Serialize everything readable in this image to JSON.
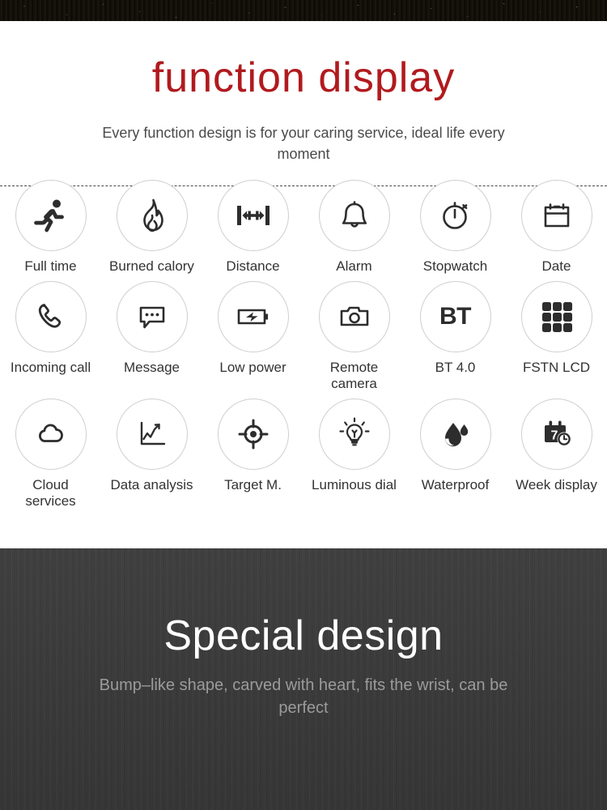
{
  "header": {
    "title": "function display",
    "subtitle": "Every function design is for your caring service, ideal life every moment"
  },
  "colors": {
    "title_red": "#b11a1e",
    "label_gray": "#333333",
    "icon_dark": "#2d2d2d",
    "circle_border": "#cfcfcf",
    "bottom_bg": "#3b3b3b",
    "bottom_subtitle": "#9b9b9b"
  },
  "features": [
    {
      "icon": "running-man-icon",
      "label": "Full time"
    },
    {
      "icon": "flame-icon",
      "label": "Burned calory"
    },
    {
      "icon": "distance-measure-icon",
      "label": "Distance"
    },
    {
      "icon": "bell-icon",
      "label": "Alarm"
    },
    {
      "icon": "stopwatch-icon",
      "label": "Stopwatch"
    },
    {
      "icon": "calendar-icon",
      "label": "Date"
    },
    {
      "icon": "phone-handset-icon",
      "label": "Incoming call"
    },
    {
      "icon": "speech-bubble-icon",
      "label": "Message"
    },
    {
      "icon": "battery-bolt-icon",
      "label": "Low power"
    },
    {
      "icon": "camera-icon",
      "label": "Remote camera"
    },
    {
      "icon": "bluetooth-text-icon",
      "label": "BT 4.0",
      "icon_text": "BT"
    },
    {
      "icon": "grid-squares-icon",
      "label": "FSTN LCD"
    },
    {
      "icon": "cloud-icon",
      "label": "Cloud services"
    },
    {
      "icon": "line-chart-icon",
      "label": "Data analysis"
    },
    {
      "icon": "crosshair-target-icon",
      "label": "Target M."
    },
    {
      "icon": "lightbulb-icon",
      "label": "Luminous dial"
    },
    {
      "icon": "water-drop-icon",
      "label": "Waterproof"
    },
    {
      "icon": "calendar-clock-icon",
      "label": "Week display",
      "icon_text": "7"
    }
  ],
  "bottom": {
    "title": "Special design",
    "subtitle": "Bump–like shape, carved with heart, fits the wrist, can be perfect"
  }
}
